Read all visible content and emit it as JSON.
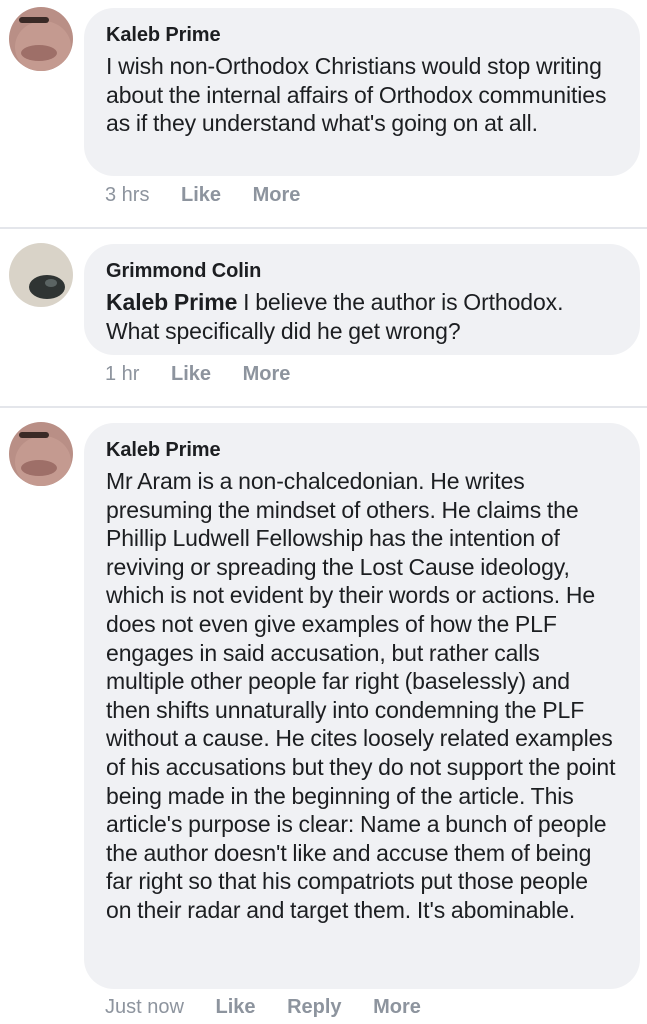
{
  "comments": [
    {
      "author": "Kaleb Prime",
      "mention": "",
      "text": "I wish non-Orthodox Christians would stop writing about the internal affairs of Orthodox communities as if they understand what's going on at all.",
      "time": "3 hrs",
      "actions": [
        "Like",
        "More"
      ]
    },
    {
      "author": "Grimmond Colin",
      "mention": "Kaleb Prime",
      "text": "I believe the author is Orthodox. What specifically did he get wrong?",
      "time": "1 hr",
      "actions": [
        "Like",
        "More"
      ]
    },
    {
      "author": "Kaleb Prime",
      "mention": "",
      "text": "Mr Aram is a non-chalcedonian. He writes presuming the mindset of others. He claims the Phillip Ludwell Fellowship has the intention of reviving or spreading the Lost Cause ideology, which is not evident by their words or actions. He does not even give examples of how the PLF engages in said accusation, but rather calls multiple other people far right (baselessly) and then shifts unnaturally into condemning the PLF without a cause. He cites loosely related examples of his accusations but they do not support the point being made in the beginning of the article. This article's purpose is clear: Name a bunch of people the author doesn't like and accuse them of being far right so that his compatriots put those people on their radar and target them. It's abominable.",
      "time": "Just now",
      "actions": [
        "Like",
        "Reply",
        "More"
      ]
    }
  ]
}
